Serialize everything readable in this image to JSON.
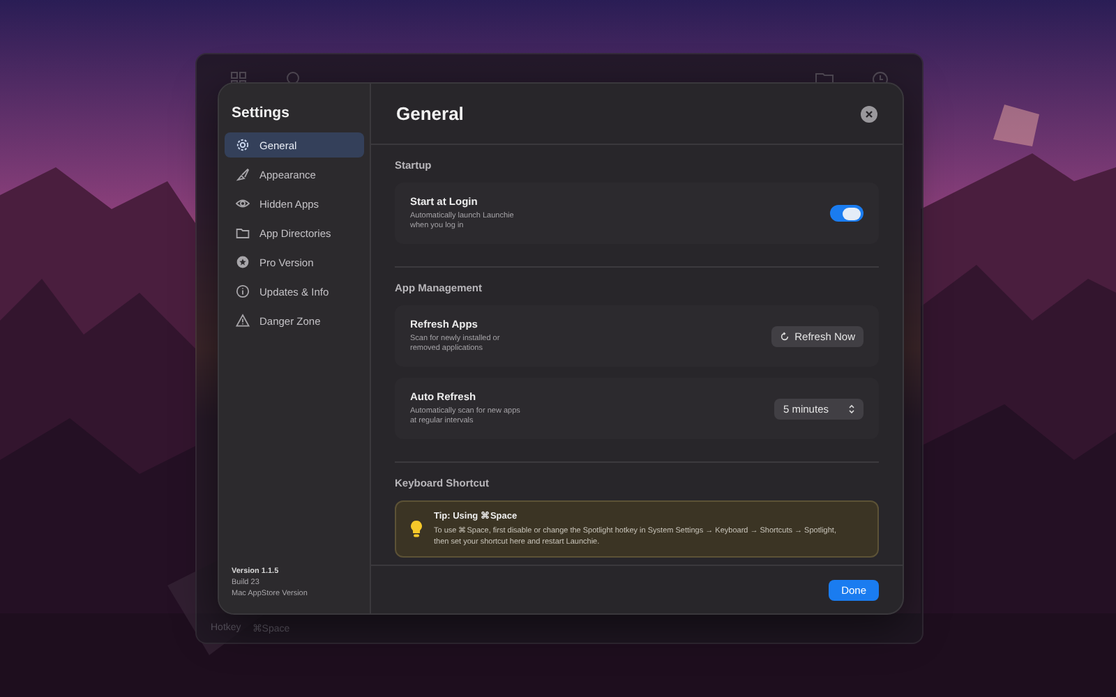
{
  "background_window": {
    "hotkey_label": "Hotkey",
    "hotkey_value": "⌘Space"
  },
  "sidebar": {
    "title": "Settings",
    "items": [
      {
        "label": "General",
        "selected": true
      },
      {
        "label": "Appearance",
        "selected": false
      },
      {
        "label": "Hidden Apps",
        "selected": false
      },
      {
        "label": "App Directories",
        "selected": false
      },
      {
        "label": "Pro Version",
        "selected": false
      },
      {
        "label": "Updates & Info",
        "selected": false
      },
      {
        "label": "Danger Zone",
        "selected": false
      }
    ],
    "version": "Version 1.1.5",
    "build": "Build 23",
    "edition": "Mac AppStore Version"
  },
  "main": {
    "title": "General",
    "sections": [
      {
        "title": "Startup",
        "rows": [
          {
            "kind": "toggle",
            "title": "Start at Login",
            "description": "Automatically launch Launchie when you log in",
            "on": true
          }
        ]
      },
      {
        "title": "App Management",
        "rows": [
          {
            "kind": "button",
            "title": "Refresh Apps",
            "description": "Scan for newly installed or removed applications",
            "control": "Refresh Now"
          },
          {
            "kind": "select",
            "title": "Auto Refresh",
            "description": "Automatically scan for new apps at regular intervals",
            "control": "5 minutes"
          }
        ]
      },
      {
        "title": "Keyboard Shortcut",
        "tip": {
          "title": "Tip: Using ⌘Space",
          "text": "To use ⌘Space, first disable or change the Spotlight hotkey in System Settings → Keyboard → Shortcuts → Spotlight, then set your shortcut here and restart Launchie."
        }
      }
    ]
  },
  "footer": {
    "button": "Done"
  }
}
